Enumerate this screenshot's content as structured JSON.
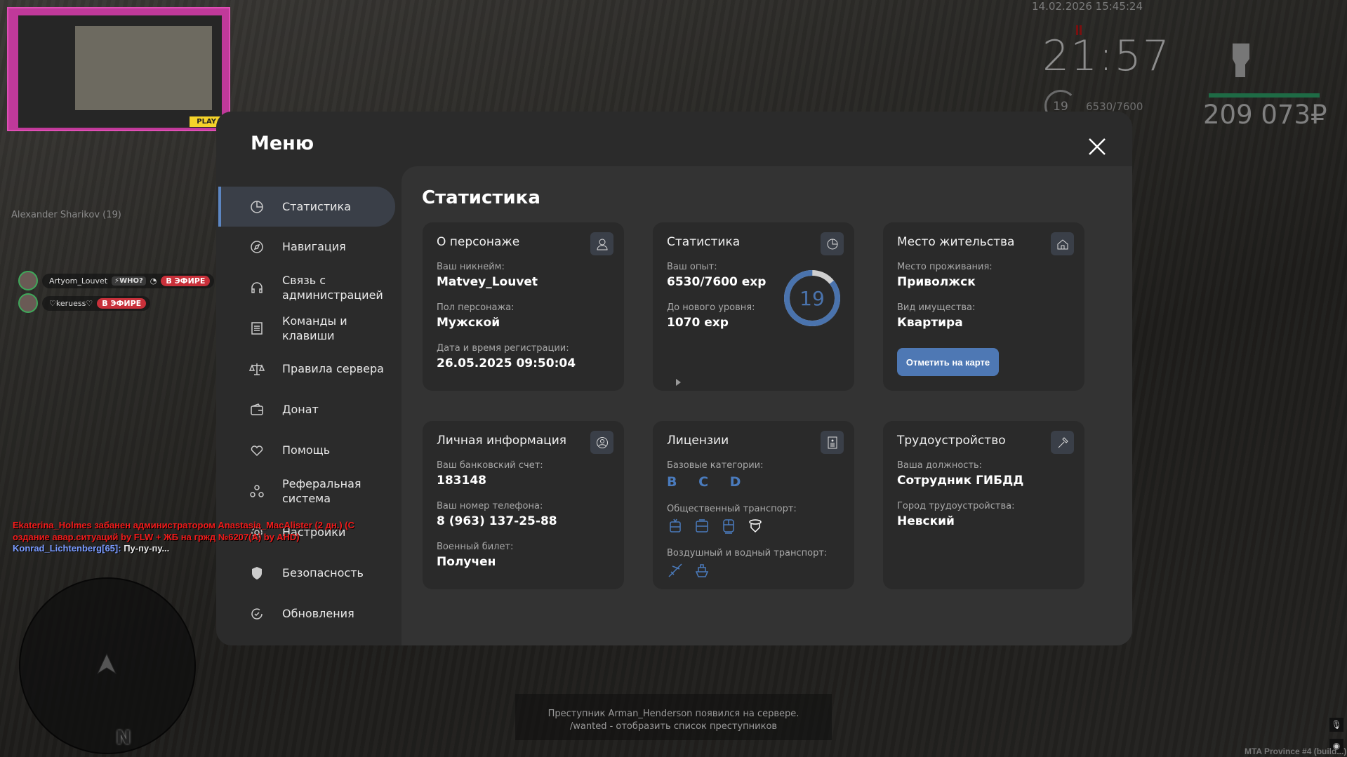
{
  "hud": {
    "datetime": "14.02.2026 15:45:24",
    "clock": "21:57",
    "level": "19",
    "exp": "6530/7600",
    "money": "209 073₽"
  },
  "stream_thumbnail": {
    "play_label": "PLAY"
  },
  "world": {
    "nametag": "Alexander Sharikov (19)",
    "voice": [
      {
        "name": "Artyom_Louvet",
        "badge": "⚡WHO?",
        "live": "В ЭФИРЕ"
      },
      {
        "name": "♡keruess♡",
        "live": "В ЭФИРЕ"
      }
    ],
    "chat": [
      {
        "text": "Ekaterina_Holmes забанен администратором Anastasia_MacAlister (2 дн.) (С"
      },
      {
        "text": "оздание авар.ситуаций by FLW + ЖБ на гржд №6207(A) by AHD)"
      },
      {
        "name": "Konrad_Lichtenberg[65]:",
        "text": " Пу-пу-пу..."
      }
    ],
    "radar_north": "N",
    "notice_line1": "Преступник Arman_Henderson появился на сервере.",
    "notice_line2": "/wanted - отобразить список преступников",
    "server": "MTA Province #4 (build...)"
  },
  "menu": {
    "title": "Меню",
    "sidebar": [
      {
        "label": "Статистика",
        "icon": "pie-chart-icon",
        "active": true
      },
      {
        "label": "Навигация",
        "icon": "compass-icon"
      },
      {
        "label": "Связь с администрацией",
        "icon": "headset-icon"
      },
      {
        "label": "Команды и клавиши",
        "icon": "list-icon"
      },
      {
        "label": "Правила сервера",
        "icon": "scales-icon"
      },
      {
        "label": "Донат",
        "icon": "wallet-icon"
      },
      {
        "label": "Помощь",
        "icon": "heart-hand-icon"
      },
      {
        "label": "Реферальная система",
        "icon": "referral-icon"
      },
      {
        "label": "Настройки",
        "icon": "gear-icon"
      },
      {
        "label": "Безопасность",
        "icon": "shield-icon"
      },
      {
        "label": "Обновления",
        "icon": "refresh-check-icon"
      }
    ],
    "content_title": "Статистика",
    "cards": {
      "character": {
        "title": "О персонаже",
        "nick_label": "Ваш никнейм:",
        "nick": "Matvey_Louvet",
        "gender_label": "Пол персонажа:",
        "gender": "Мужской",
        "reg_label": "Дата и время регистрации:",
        "reg": "26.05.2025 09:50:04"
      },
      "stats": {
        "title": "Статистика",
        "exp_label": "Ваш опыт:",
        "exp": "6530/7600 exp",
        "next_label": "До нового уровня:",
        "next": "1070 exp",
        "level": "19",
        "progress": 0.859
      },
      "residence": {
        "title": "Место жительства",
        "place_label": "Место проживания:",
        "place": "Приволжск",
        "type_label": "Вид имущества:",
        "type": "Квартира",
        "button": "Отметить на карте"
      },
      "personal": {
        "title": "Личная информация",
        "bank_label": "Ваш банковский счет:",
        "bank": "183148",
        "phone_label": "Ваш номер телефона:",
        "phone": "8 (963) 137-25-88",
        "military_label": "Военный билет:",
        "military": "Получен"
      },
      "licenses": {
        "title": "Лицензии",
        "base_label": "Базовые категории:",
        "base": "B C D",
        "public_label": "Общественный транспорт:",
        "air_label": "Воздушный и водный транспорт:"
      },
      "job": {
        "title": "Трудоустройство",
        "position_label": "Ваша должность:",
        "position": "Сотрудник ГИБДД",
        "city_label": "Город трудоустройства:",
        "city": "Невский"
      }
    },
    "colors": {
      "accent": "#4e78b4",
      "panel": "#2b2b2b",
      "content": "#333333",
      "card": "#2a2a2a"
    }
  }
}
